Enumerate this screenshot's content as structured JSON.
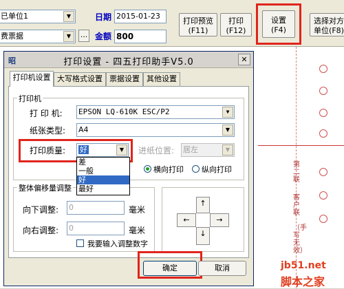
{
  "toolbar": {
    "unit_combo": "已单位1",
    "doc_combo": "费票据",
    "more_btn": "...",
    "date_label": "日期",
    "date_value": "2015-01-23",
    "amount_label": "金额",
    "amount_value": "800",
    "buttons": [
      {
        "line1": "打印预览",
        "line2": "(F11)"
      },
      {
        "line1": "打印",
        "line2": "(F12)"
      },
      {
        "line1": "设置",
        "line2": "(F4)"
      },
      {
        "line1": "选择对方",
        "line2": "单位(F8)"
      }
    ]
  },
  "report": {
    "side_text_1": "第二联",
    "side_text_2": "客户联",
    "side_text_3": "（手写无效）"
  },
  "dialog": {
    "icon_text": "昭",
    "title": "打印设置 - 四五打印助手V5.0",
    "close": "✕",
    "tabs": [
      "打印机设置",
      "大写格式设置",
      "票据设置",
      "其他设置"
    ],
    "printer_group": "打印机",
    "printer_label": "打 印 机:",
    "printer_value": "EPSON LQ-610K ESC/P2",
    "paper_label": "纸张类型:",
    "paper_value": "A4",
    "quality_label": "打印质量:",
    "quality_value": "好",
    "quality_options": [
      "差",
      "一般",
      "好",
      "最好"
    ],
    "quality_selected": 2,
    "feed_label": "进纸位置:",
    "feed_value": "居左",
    "orient_landscape": "横向打印",
    "orient_portrait": "纵向打印",
    "offset_group": "整体偏移量调整",
    "down_label": "向下调整:",
    "down_value": "0",
    "right_label": "向右调整:",
    "right_value": "0",
    "unit_mm": "毫米",
    "manual_input": "我要输入调整数字",
    "arrow_up": "↑",
    "arrow_down": "↓",
    "arrow_left": "←",
    "arrow_right": "→",
    "ok": "确定",
    "cancel": "取消"
  },
  "watermark": {
    "site": "jb51.net",
    "brand": "脚本之家"
  },
  "colors": {
    "highlight": "#e0241c",
    "selection": "#316ac5",
    "label_blue": "#0000c0"
  }
}
